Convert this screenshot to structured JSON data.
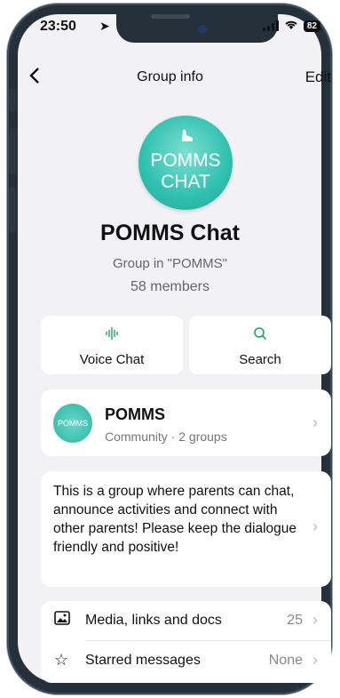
{
  "status_bar": {
    "time": "23:50",
    "battery": "82"
  },
  "nav": {
    "back": "<",
    "title": "Group info",
    "edit": "Edit"
  },
  "group": {
    "avatar_line1": "POMMS",
    "avatar_line2": "CHAT",
    "name": "POMMS Chat",
    "subtitle": "Group in \"POMMS\"",
    "members": "58 members"
  },
  "actions": [
    {
      "label": "Voice Chat",
      "icon": "voice-wave-icon"
    },
    {
      "label": "Search",
      "icon": "search-icon"
    }
  ],
  "community": {
    "avatar_text": "POMMS",
    "name": "POMMS",
    "subtitle": "Community · 2 groups"
  },
  "description": "This is a group where parents can chat, announce activities and connect with other parents! Please keep the dialogue friendly and positive!",
  "list": [
    {
      "icon": "image-icon",
      "label": "Media, links and docs",
      "value": "25"
    },
    {
      "icon": "star-icon",
      "label": "Starred messages",
      "value": "None"
    }
  ],
  "colors": {
    "accent": "#25a36a",
    "avatar": "#2fc0b0",
    "background": "#f2f2f4"
  }
}
